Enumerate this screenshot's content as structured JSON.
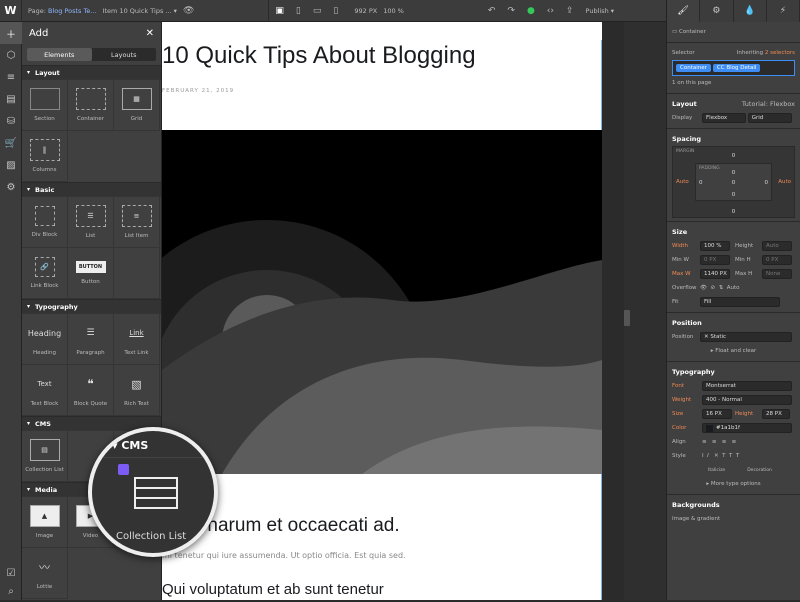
{
  "topbar": {
    "page_label": "Page:",
    "page_name": "Blog Posts Te...",
    "item_label": "Item",
    "item_name": "10 Quick Tips ...",
    "width_value": "992",
    "width_unit": "PX",
    "zoom": "100 %",
    "publish_label": "Publish"
  },
  "add_panel": {
    "title": "Add",
    "tabs": [
      "Elements",
      "Layouts"
    ],
    "sections": [
      {
        "name": "Layout",
        "items": [
          "Section",
          "Container",
          "Grid",
          "Columns"
        ]
      },
      {
        "name": "Basic",
        "items": [
          "Div Block",
          "List",
          "List Item",
          "Link Block",
          "Button"
        ]
      },
      {
        "name": "Typography",
        "items": [
          "Heading",
          "Paragraph",
          "Text Link",
          "Text Block",
          "Block Quote",
          "Rich Text"
        ]
      },
      {
        "name": "CMS",
        "items": [
          "Collection List"
        ]
      },
      {
        "name": "Media",
        "items": [
          "Image",
          "Video",
          "Lottie"
        ]
      }
    ],
    "button_glyph": "BUTTON",
    "heading_glyph": "Heading",
    "link_glyph": "Link",
    "text_glyph": "Text"
  },
  "magnifier": {
    "section": "CMS",
    "label": "Collection List"
  },
  "canvas": {
    "title": "10 Quick Tips About Blogging",
    "date": "FEBRUARY 21, 2019",
    "heading2": "a hic harum et occaecati ad.",
    "paragraph": "mi tenetur qui iure assumenda. Ut optio officia. Est quia sed.",
    "heading3": "Qui voluptatum et ab sunt tenetur"
  },
  "style_panel": {
    "element_type": "Container",
    "selector_label": "Selector",
    "inheriting": "Inheriting",
    "inheriting_count": "2 selectors",
    "chips": [
      "Container",
      "CC Blog Detail"
    ],
    "on_page": "1 on this page",
    "layout": {
      "title": "Layout",
      "tutorial": "Tutorial: Flexbox",
      "display_label": "Display",
      "options": [
        "Flexbox",
        "Grid"
      ]
    },
    "spacing": {
      "title": "Spacing",
      "margin_label": "MARGIN",
      "padding_label": "PADDING",
      "margin_top": "0",
      "padding_top": "0",
      "left": "Auto",
      "right": "Auto",
      "pad_left": "0",
      "pad_right": "0",
      "center": "0",
      "pad_bottom": "0",
      "margin_bottom": "0"
    },
    "size": {
      "title": "Size",
      "width_label": "Width",
      "width_value": "100",
      "width_unit": "%",
      "height_label": "Height",
      "height_value": "Auto",
      "minw_label": "Min W",
      "minw_value": "0",
      "minw_unit": "PX",
      "minh_label": "Min H",
      "minh_value": "0",
      "minh_unit": "PX",
      "maxw_label": "Max W",
      "maxw_value": "1140",
      "maxw_unit": "PX",
      "maxh_label": "Max H",
      "maxh_value": "None",
      "overflow_label": "Overflow",
      "overflow_auto": "Auto",
      "fit_label": "Fit",
      "fit_value": "Fill"
    },
    "position": {
      "title": "Position",
      "label": "Position",
      "value": "Static",
      "float": "Float and clear"
    },
    "typography": {
      "title": "Typography",
      "font_label": "Font",
      "font_value": "Montserrat",
      "weight_label": "Weight",
      "weight_value": "400 - Normal",
      "size_label": "Size",
      "size_value": "16",
      "size_unit": "PX",
      "height_label": "Height",
      "height_value": "28",
      "height_unit": "PX",
      "color_label": "Color",
      "color_value": "#1a1b1f",
      "align_label": "Align",
      "style_label": "Style",
      "italicize": "Italicize",
      "decoration": "Decoration",
      "more": "More type options"
    },
    "backgrounds": {
      "title": "Backgrounds",
      "sub": "Image & gradient"
    }
  },
  "colors": {
    "accent": "#3d8df5",
    "publish_ok": "#34c759",
    "orange": "#f08a54"
  }
}
